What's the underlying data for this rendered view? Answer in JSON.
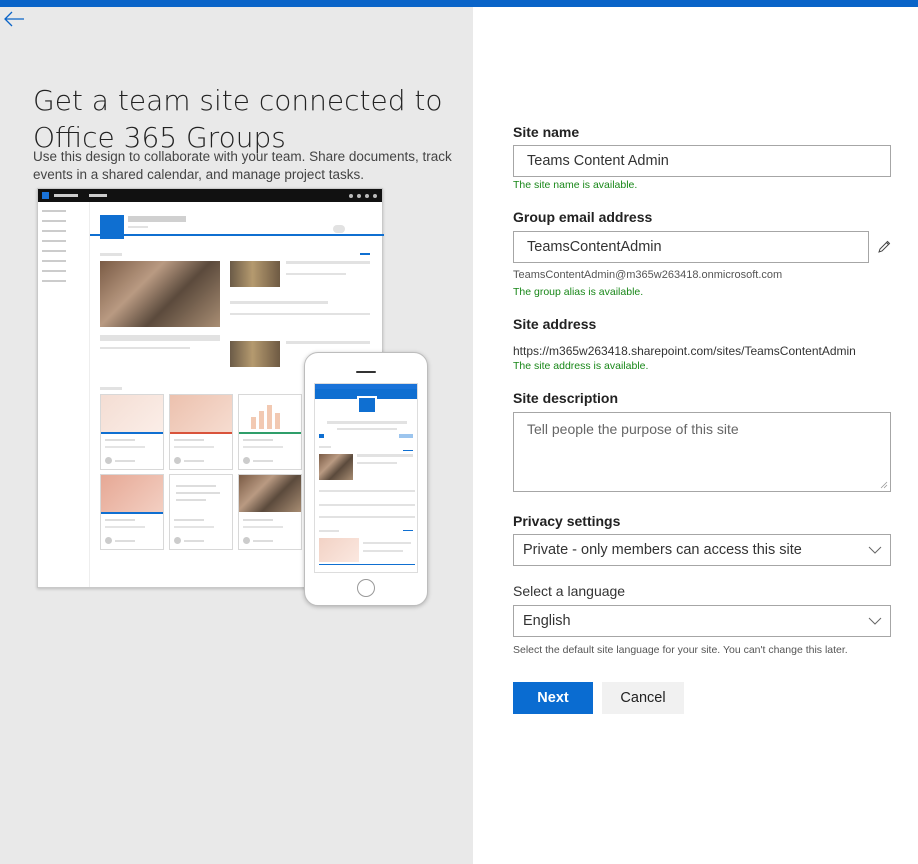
{
  "hero": {
    "title": "Get a team site connected to Office 365 Groups",
    "description": "Use this design to collaborate with your team. Share documents, track events in a shared calendar, and manage project tasks."
  },
  "form": {
    "site_name": {
      "label": "Site name",
      "value": "Teams Content Admin",
      "status": "The site name is available."
    },
    "group_email": {
      "label": "Group email address",
      "value": "TeamsContentAdmin",
      "full_address": "TeamsContentAdmin@m365w263418.onmicrosoft.com",
      "status": "The group alias is available."
    },
    "site_address": {
      "label": "Site address",
      "value": "https://m365w263418.sharepoint.com/sites/TeamsContentAdmin",
      "status": "The site address is available."
    },
    "site_description": {
      "label": "Site description",
      "placeholder": "Tell people the purpose of this site"
    },
    "privacy": {
      "label": "Privacy settings",
      "selected": "Private - only members can access this site"
    },
    "language": {
      "label": "Select a language",
      "selected": "English",
      "hint": "Select the default site language for your site. You can't change this later."
    },
    "buttons": {
      "next": "Next",
      "cancel": "Cancel"
    }
  },
  "colors": {
    "accent": "#0a6cd1",
    "success": "#188718",
    "left_pane_bg": "#e9e9e9"
  }
}
